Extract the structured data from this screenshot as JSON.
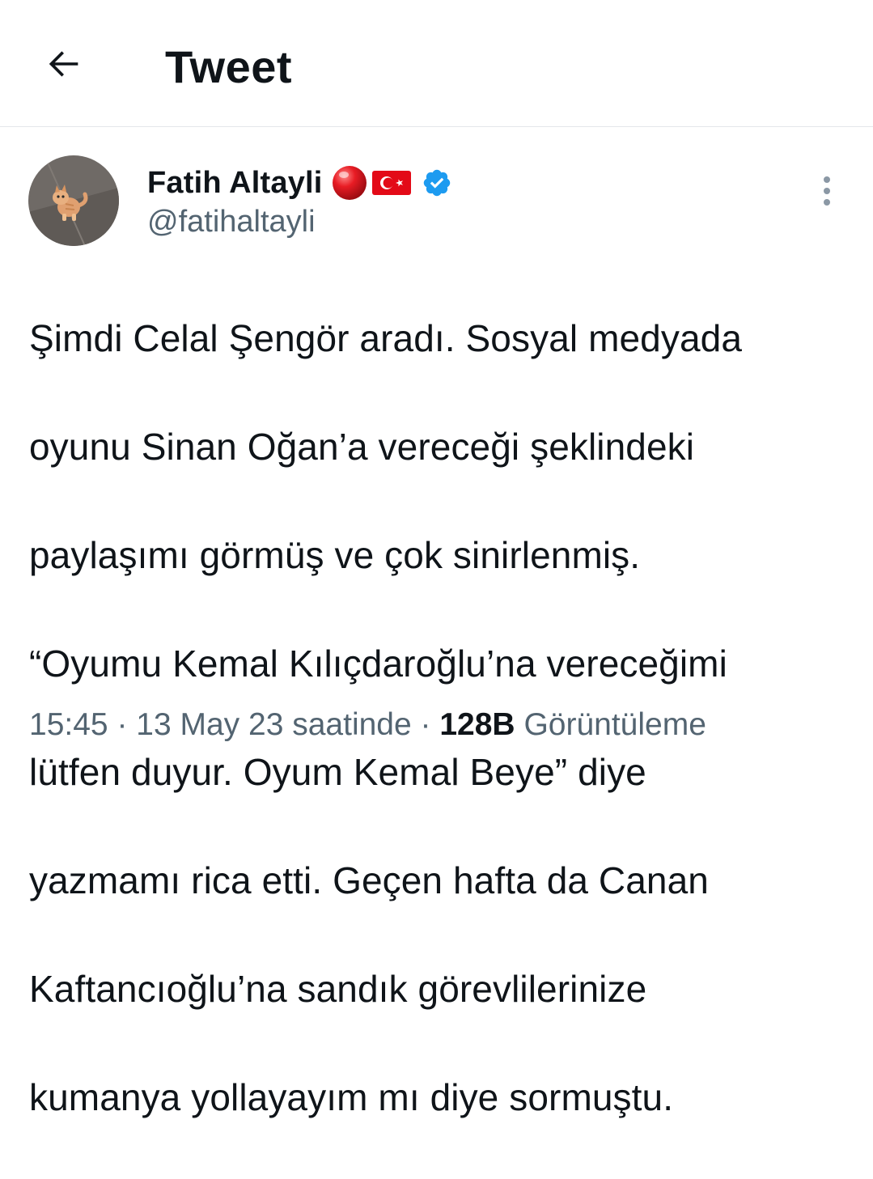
{
  "header": {
    "title": "Tweet",
    "back_icon": "arrow-left-icon"
  },
  "author": {
    "name": "Fatih Altayli",
    "handle": "@fatihaltayli",
    "avatar_icon": "kitten-avatar",
    "badges": [
      "red-ball-emoji",
      "turkey-flag-emoji",
      "verified-badge-icon"
    ]
  },
  "tweet": {
    "lines": [
      "Şimdi Celal Şengör aradı. Sosyal medyada",
      "oyunu Sinan Oğan’a vereceği şeklindeki",
      "paylaşımı görmüş ve çok sinirlenmiş.",
      "“Oyumu Kemal Kılıçdaroğlu’na vereceğimi",
      "lütfen duyur. Oyum Kemal Beye” diye",
      "yazmamı rica etti. Geçen hafta da Canan",
      "Kaftancıoğlu’na sandık görevlilerinize",
      "kumanya yollayayım mı diye sormuştu."
    ]
  },
  "meta": {
    "time": "15:45",
    "separator": " · ",
    "date": "13 May 23 saatinde",
    "views_count": "128B",
    "views_label": "Görüntüleme"
  },
  "colors": {
    "text": "#0f1419",
    "secondary": "#536471",
    "verified": "#1d9bf0",
    "divider": "#e4e7ea"
  }
}
